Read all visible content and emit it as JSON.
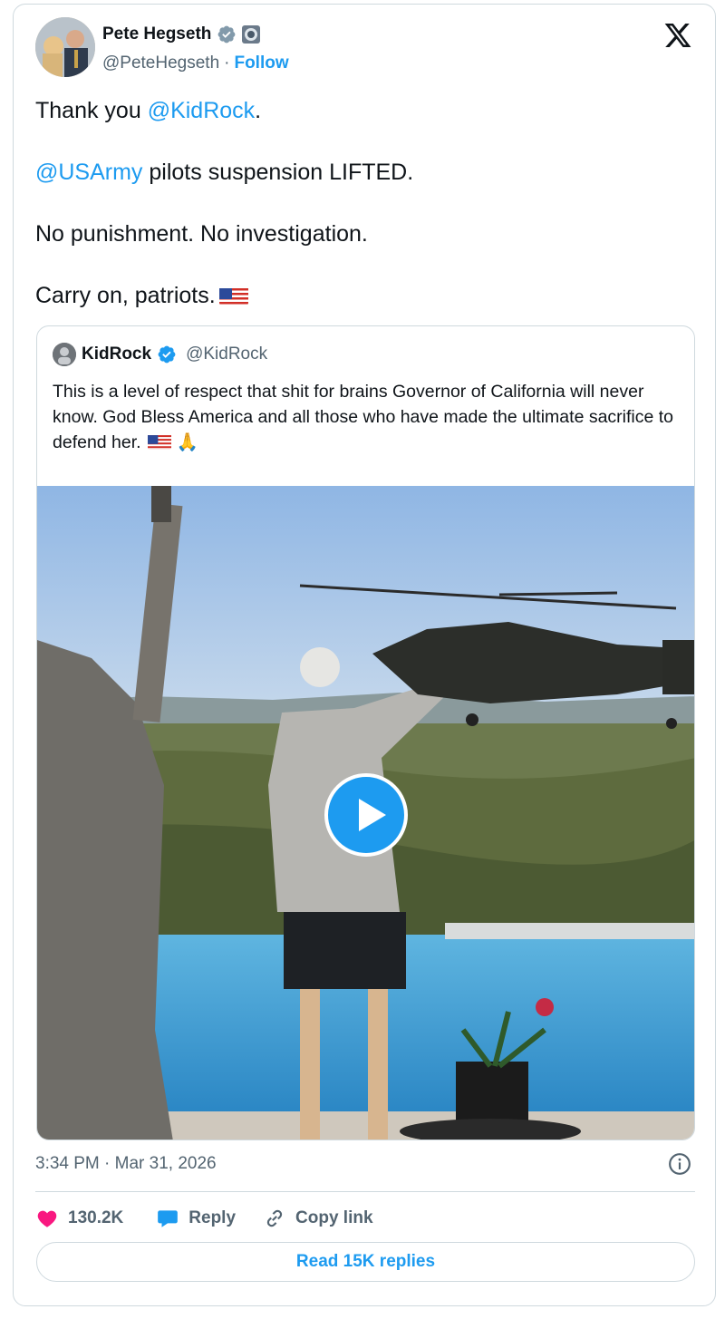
{
  "author": {
    "name": "Pete Hegseth",
    "handle": "@PeteHegseth",
    "separator": "·",
    "follow_label": "Follow"
  },
  "tweet": {
    "line1_prefix": "Thank you ",
    "line1_mention": "@KidRock",
    "line1_suffix": ".",
    "line2_mention": "@USArmy",
    "line2_suffix": " pilots suspension LIFTED.",
    "line3": "No punishment. No investigation.",
    "line4": "Carry on, patriots."
  },
  "quote": {
    "name": "KidRock",
    "handle": "@KidRock",
    "text": "This is a level of respect that shit for brains Governor of California will never know. God Bless America and all those who have made the ultimate sacrifice to defend her.",
    "trailing_emoji": "🙏"
  },
  "footer": {
    "timestamp": "3:34 PM · Mar 31, 2026",
    "likes": "130.2K",
    "reply_label": "Reply",
    "copy_label": "Copy link",
    "read_replies": "Read 15K replies"
  },
  "icons": [
    "verified-badge-icon",
    "government-affiliation-icon",
    "x-logo-icon",
    "play-icon",
    "info-icon",
    "heart-icon",
    "reply-bubble-icon",
    "link-icon"
  ],
  "colors": {
    "accent": "#1d9bf0",
    "like": "#f91880",
    "text": "#0f1419",
    "muted": "#536471",
    "border": "#cfd9de"
  }
}
